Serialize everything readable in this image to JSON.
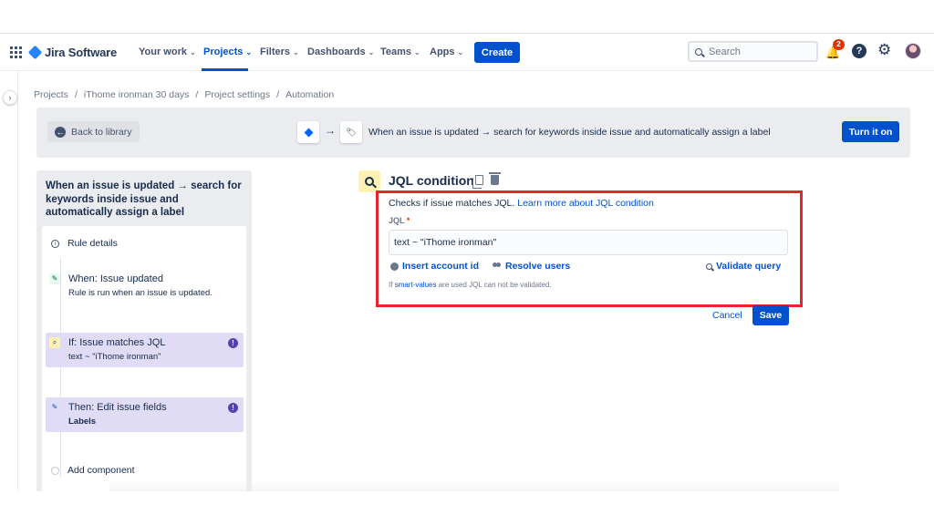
{
  "nav": {
    "logo": "Jira Software",
    "items": [
      {
        "label": "Your work"
      },
      {
        "label": "Projects"
      },
      {
        "label": "Filters"
      },
      {
        "label": "Dashboards"
      },
      {
        "label": "Teams"
      },
      {
        "label": "Apps"
      }
    ],
    "create_label": "Create",
    "search_placeholder": "Search",
    "notification_count": "2",
    "help_symbol": "?"
  },
  "breadcrumb": [
    "Projects",
    "iThome ironman 30 days",
    "Project settings",
    "Automation"
  ],
  "library_bar": {
    "back_label": "Back to library",
    "rule_summary": "When an issue is updated → search for keywords inside issue and automatically assign a label",
    "turn_on_label": "Turn it on"
  },
  "rule": {
    "title": "When an issue is updated → search for keywords inside issue and automatically assign a label",
    "details_label": "Rule details",
    "steps": [
      {
        "title": "When: Issue updated",
        "sub": "Rule is run when an issue is updated."
      },
      {
        "title": "If: Issue matches JQL",
        "sub": "text ~ \"iThome ironman\""
      },
      {
        "title": "Then: Edit issue fields",
        "sub": "Labels"
      }
    ],
    "add_component_label": "Add component"
  },
  "editor": {
    "title": "JQL condition",
    "description": "Checks if issue matches JQL.",
    "learn_more": "Learn more about JQL condition",
    "jql_label": "JQL",
    "required_mark": "*",
    "jql_value": "text ~ \"iThome ironman\"",
    "insert_account_label": "Insert account id",
    "resolve_users_label": "Resolve users",
    "validate_label": "Validate query",
    "note_prefix": "If",
    "note_link": "smart-values",
    "note_suffix": "are used JQL can not be validated.",
    "cancel_label": "Cancel",
    "save_label": "Save"
  },
  "colors": {
    "brand": "#0052cc",
    "highlight": "#e5262a",
    "selected_step": "#e0dcf6"
  }
}
